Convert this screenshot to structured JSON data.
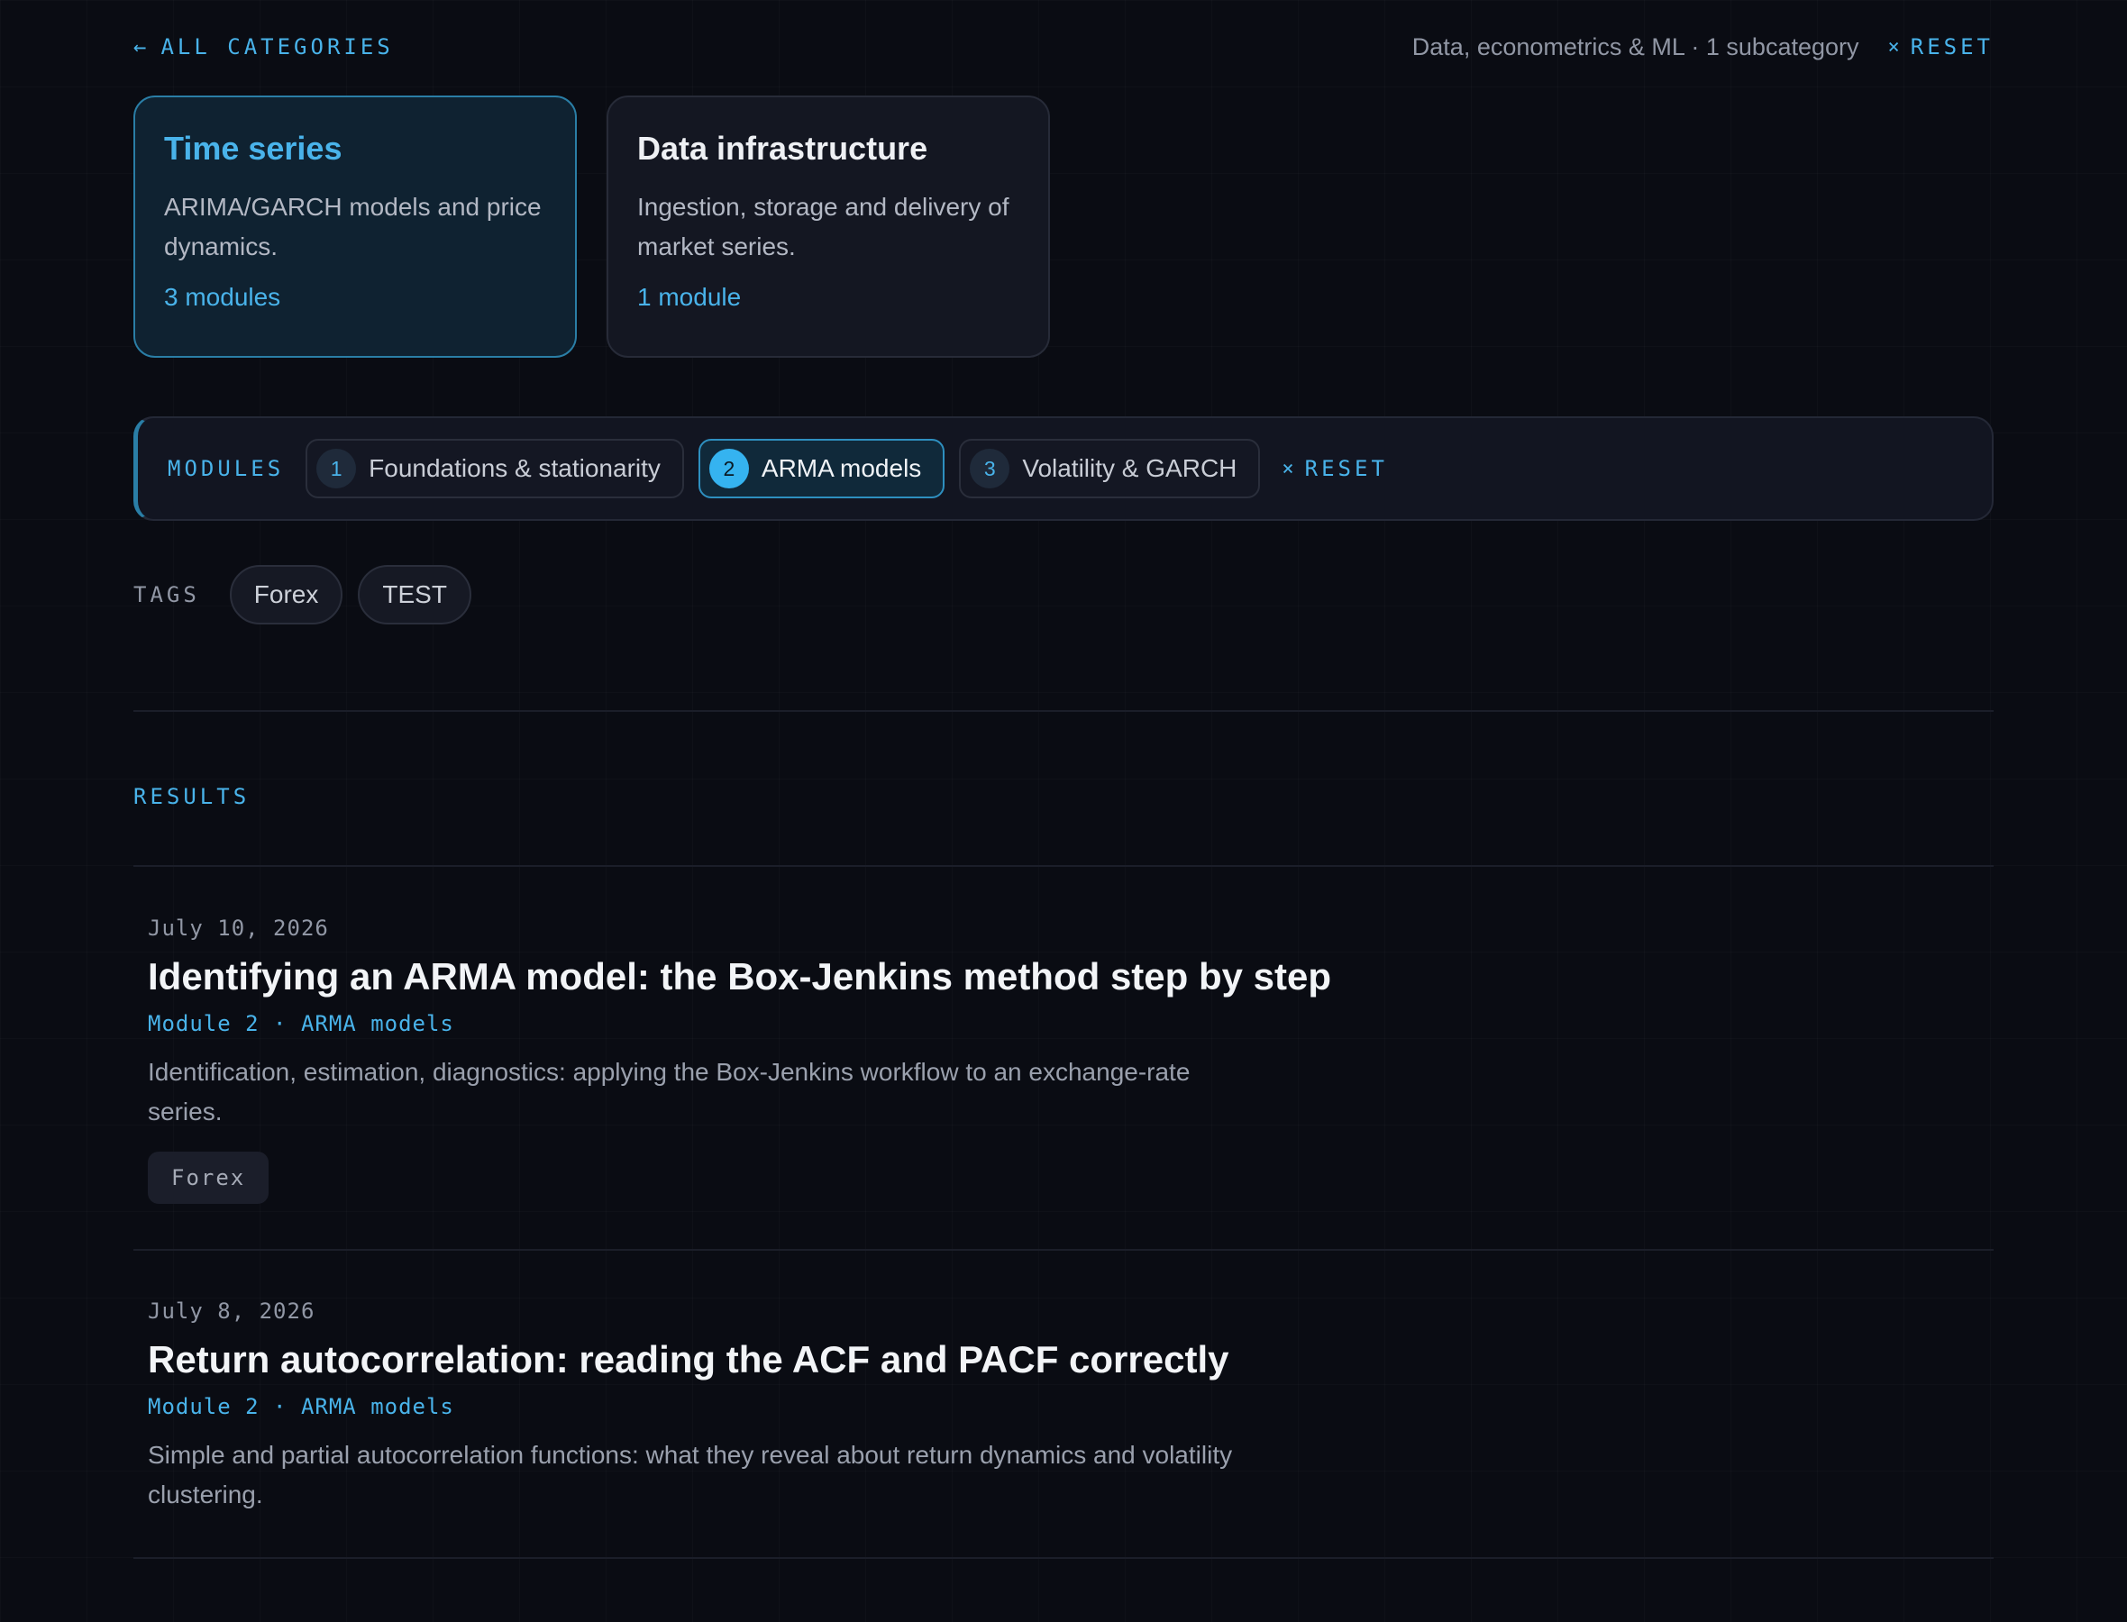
{
  "topbar": {
    "back_icon": "←",
    "back_label": "ALL CATEGORIES",
    "summary": "Data, econometrics & ML · 1 subcategory",
    "reset_icon": "×",
    "reset_label": "RESET"
  },
  "categories": [
    {
      "title": "Time series",
      "description": "ARIMA/GARCH models and price dynamics.",
      "count": "3 modules",
      "active": true
    },
    {
      "title": "Data infrastructure",
      "description": "Ingestion, storage and delivery of market series.",
      "count": "1 module",
      "active": false
    }
  ],
  "modules": {
    "label": "MODULES",
    "items": [
      {
        "num": "1",
        "name": "Foundations & stationarity",
        "active": false
      },
      {
        "num": "2",
        "name": "ARMA models",
        "active": true
      },
      {
        "num": "3",
        "name": "Volatility & GARCH",
        "active": false
      }
    ],
    "reset_icon": "×",
    "reset_label": "RESET"
  },
  "tags": {
    "label": "TAGS",
    "items": [
      "Forex",
      "TEST"
    ]
  },
  "results": {
    "label": "RESULTS",
    "items": [
      {
        "date": "July 10, 2026",
        "title": "Identifying an ARMA model: the Box-Jenkins method step by step",
        "meta": "Module 2 · ARMA models",
        "excerpt": "Identification, estimation, diagnostics: applying the Box-Jenkins workflow to an exchange-rate series.",
        "tag": "Forex"
      },
      {
        "date": "July 8, 2026",
        "title": "Return autocorrelation: reading the ACF and PACF correctly",
        "meta": "Module 2 · ARMA models",
        "excerpt": "Simple and partial autocorrelation functions: what they reveal about return dynamics and volatility clustering."
      }
    ]
  },
  "colors": {
    "accent": "#49b3ea",
    "background": "#0a0c13",
    "card_active_border": "#2a7ea6"
  }
}
